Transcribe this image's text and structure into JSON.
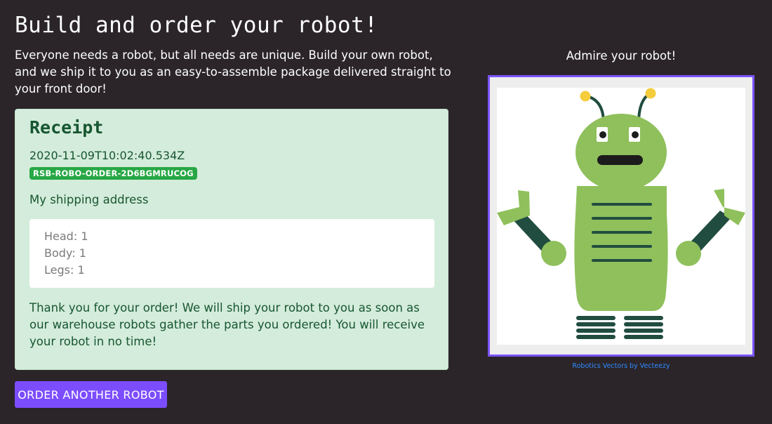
{
  "header": {
    "title": "Build and order your robot!",
    "intro": "Everyone needs a robot, but all needs are unique. Build your own robot, and we ship it to you as an easy-to-assemble package delivered straight to your front door!"
  },
  "receipt": {
    "title": "Receipt",
    "timestamp": "2020-11-09T10:02:40.534Z",
    "order_id": "RSB-ROBO-ORDER-2D6BGMRUCOG",
    "address": "My shipping address",
    "parts": [
      {
        "label": "Head: 1"
      },
      {
        "label": "Body: 1"
      },
      {
        "label": "Legs: 1"
      }
    ],
    "thanks": "Thank you for your order! We will ship your robot to you as soon as our warehouse robots gather the parts you ordered! You will receive your robot in no time!"
  },
  "actions": {
    "order_another_label": "ORDER ANOTHER ROBOT"
  },
  "preview": {
    "heading": "Admire your robot!",
    "credit": "Robotics Vectors by Vecteezy"
  },
  "colors": {
    "background": "#2b2529",
    "accent": "#7c4dff",
    "receipt_bg": "#d4ecdb",
    "receipt_text": "#175631",
    "badge": "#27a745",
    "robot_green": "#8fc05c",
    "robot_dark": "#214d40",
    "antenna_tip": "#f5cc3c"
  }
}
